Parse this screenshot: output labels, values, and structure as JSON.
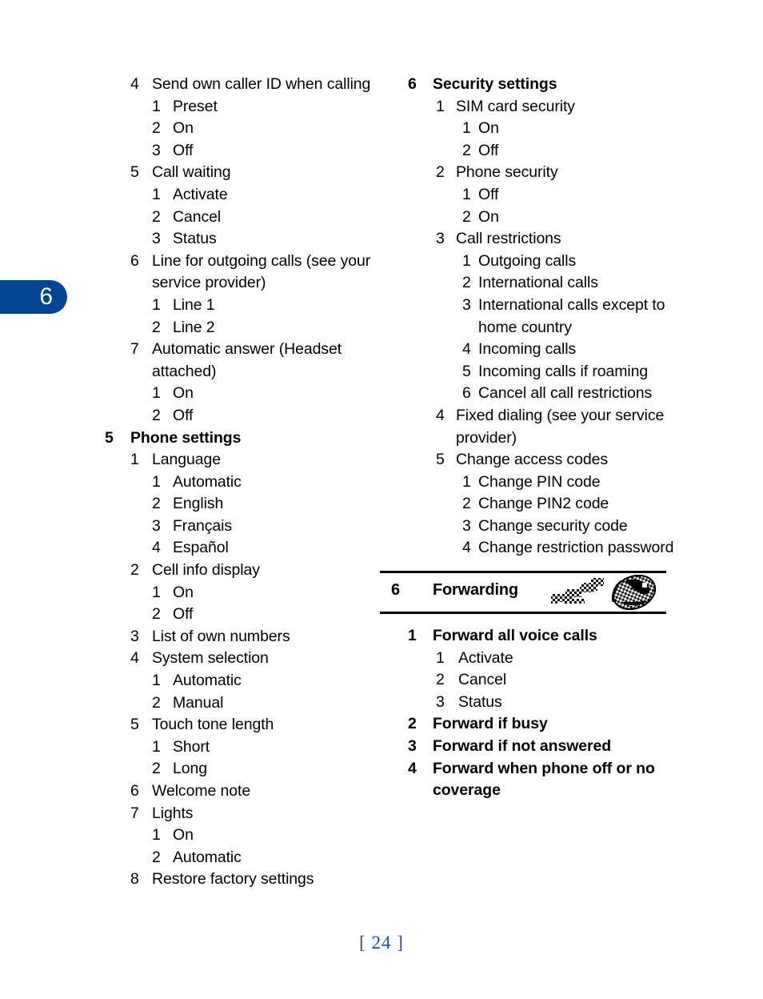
{
  "chapter_tab": {
    "number": "6",
    "color": "#014593"
  },
  "page_number": "[ 24 ]",
  "left_column": {
    "rows": [
      {
        "level": 1,
        "num": "4",
        "text": "Send own caller ID when calling",
        "bold": false
      },
      {
        "level": 2,
        "num": "1",
        "text": "Preset",
        "bold": false
      },
      {
        "level": 2,
        "num": "2",
        "text": "On",
        "bold": false
      },
      {
        "level": 2,
        "num": "3",
        "text": "Off",
        "bold": false
      },
      {
        "level": 1,
        "num": "5",
        "text": "Call waiting",
        "bold": false
      },
      {
        "level": 2,
        "num": "1",
        "text": "Activate",
        "bold": false
      },
      {
        "level": 2,
        "num": "2",
        "text": "Cancel",
        "bold": false
      },
      {
        "level": 2,
        "num": "3",
        "text": "Status",
        "bold": false
      },
      {
        "level": 1,
        "num": "6",
        "text": "Line for outgoing calls (see your service provider)",
        "bold": false
      },
      {
        "level": 2,
        "num": "1",
        "text": "Line 1",
        "bold": false
      },
      {
        "level": 2,
        "num": "2",
        "text": "Line 2",
        "bold": false
      },
      {
        "level": 1,
        "num": "7",
        "text": "Automatic answer (Headset attached)",
        "bold": false
      },
      {
        "level": 2,
        "num": "1",
        "text": "On",
        "bold": false
      },
      {
        "level": 2,
        "num": "2",
        "text": "Off",
        "bold": false
      },
      {
        "level": 0,
        "num": "5",
        "text": "Phone settings",
        "bold": true
      },
      {
        "level": 1,
        "num": "1",
        "text": "Language",
        "bold": false
      },
      {
        "level": 2,
        "num": "1",
        "text": "Automatic",
        "bold": false
      },
      {
        "level": 2,
        "num": "2",
        "text": "English",
        "bold": false
      },
      {
        "level": 2,
        "num": "3",
        "text": "Français",
        "bold": false
      },
      {
        "level": 2,
        "num": "4",
        "text": "Español",
        "bold": false
      },
      {
        "level": 1,
        "num": "2",
        "text": "Cell info display",
        "bold": false
      },
      {
        "level": 2,
        "num": "1",
        "text": "On",
        "bold": false
      },
      {
        "level": 2,
        "num": "2",
        "text": "Off",
        "bold": false
      },
      {
        "level": 1,
        "num": "3",
        "text": "List of own numbers",
        "bold": false
      },
      {
        "level": 1,
        "num": "4",
        "text": "System selection",
        "bold": false
      },
      {
        "level": 2,
        "num": "1",
        "text": "Automatic",
        "bold": false
      },
      {
        "level": 2,
        "num": "2",
        "text": "Manual",
        "bold": false
      },
      {
        "level": 1,
        "num": "5",
        "text": "Touch tone length",
        "bold": false
      },
      {
        "level": 2,
        "num": "1",
        "text": "Short",
        "bold": false
      },
      {
        "level": 2,
        "num": "2",
        "text": "Long",
        "bold": false
      },
      {
        "level": 1,
        "num": "6",
        "text": "Welcome note",
        "bold": false
      },
      {
        "level": 1,
        "num": "7",
        "text": "Lights",
        "bold": false
      },
      {
        "level": 2,
        "num": "1",
        "text": "On",
        "bold": false
      },
      {
        "level": 2,
        "num": "2",
        "text": "Automatic",
        "bold": false
      },
      {
        "level": 1,
        "num": "8",
        "text": "Restore factory settings",
        "bold": false
      }
    ]
  },
  "right_column": {
    "rows_before_header": [
      {
        "level": 0,
        "num": "6",
        "text": "Security settings",
        "bold": true
      },
      {
        "level": 1,
        "num": "1",
        "text": "SIM card security",
        "bold": false
      },
      {
        "level": 2,
        "num": "1",
        "text": "On",
        "bold": false
      },
      {
        "level": 2,
        "num": "2",
        "text": "Off",
        "bold": false
      },
      {
        "level": 1,
        "num": "2",
        "text": "Phone security",
        "bold": false
      },
      {
        "level": 2,
        "num": "1",
        "text": "Off",
        "bold": false
      },
      {
        "level": 2,
        "num": "2",
        "text": "On",
        "bold": false
      },
      {
        "level": 1,
        "num": "3",
        "text": "Call restrictions",
        "bold": false
      },
      {
        "level": 2,
        "num": "1",
        "text": "Outgoing calls",
        "bold": false
      },
      {
        "level": 2,
        "num": "2",
        "text": "International calls",
        "bold": false
      },
      {
        "level": 2,
        "num": "3",
        "text": "International calls except to home country",
        "bold": false
      },
      {
        "level": 2,
        "num": "4",
        "text": "Incoming calls",
        "bold": false
      },
      {
        "level": 2,
        "num": "5",
        "text": "Incoming calls if roaming",
        "bold": false
      },
      {
        "level": 2,
        "num": "6",
        "text": "Cancel all call restrictions",
        "bold": false
      },
      {
        "level": 1,
        "num": "4",
        "text": "Fixed dialing (see your service provider)",
        "bold": false
      },
      {
        "level": 1,
        "num": "5",
        "text": "Change access codes",
        "bold": false
      },
      {
        "level": 2,
        "num": "1",
        "text": "Change PIN code",
        "bold": false
      },
      {
        "level": 2,
        "num": "2",
        "text": "Change PIN2 code",
        "bold": false
      },
      {
        "level": 2,
        "num": "3",
        "text": "Change security code",
        "bold": false
      },
      {
        "level": 2,
        "num": "4",
        "text": "Change restriction password",
        "bold": false
      }
    ],
    "section_header": {
      "number": "6",
      "title": "Forwarding",
      "icon": "call-forwarding-globe-icon"
    },
    "rows_after_header": [
      {
        "level": 1,
        "num": "1",
        "text": "Forward all voice calls",
        "bold": true
      },
      {
        "level": 2,
        "num": "1",
        "text": "Activate",
        "bold": false
      },
      {
        "level": 2,
        "num": "2",
        "text": "Cancel",
        "bold": false
      },
      {
        "level": 2,
        "num": "3",
        "text": "Status",
        "bold": false
      },
      {
        "level": 1,
        "num": "2",
        "text": "Forward if busy",
        "bold": true
      },
      {
        "level": 1,
        "num": "3",
        "text": "Forward if not answered",
        "bold": true
      },
      {
        "level": 1,
        "num": "4",
        "text": "Forward when phone off or no coverage",
        "bold": true
      }
    ]
  }
}
